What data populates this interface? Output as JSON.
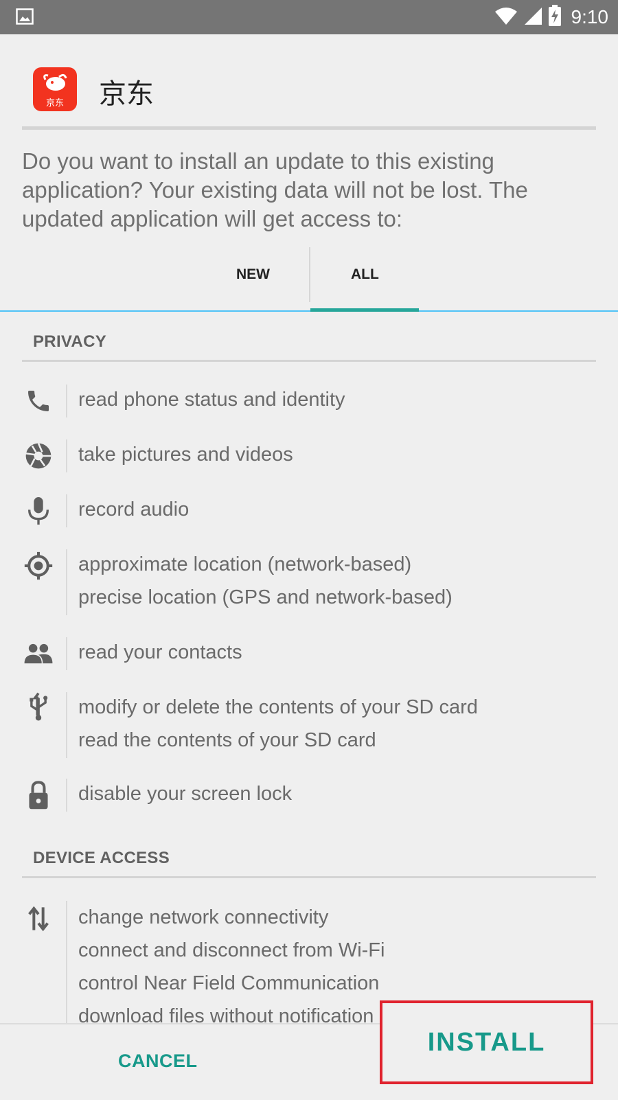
{
  "status_bar": {
    "time": "9:10",
    "icons": [
      "image-icon",
      "wifi-icon",
      "signal-icon",
      "battery-charging-icon"
    ]
  },
  "app": {
    "name": "京东",
    "icon_text": "京东",
    "icon_color": "#f2331f"
  },
  "message": "Do you want to install an update to this existing application? Your existing data will not be lost. The updated application will get access to:",
  "tabs": {
    "new": "NEW",
    "all": "ALL",
    "selected": "ALL"
  },
  "sections": {
    "privacy": {
      "title": "PRIVACY",
      "items": [
        {
          "icon": "phone-icon",
          "lines": [
            "read phone status and identity"
          ]
        },
        {
          "icon": "camera-icon",
          "lines": [
            "take pictures and videos"
          ]
        },
        {
          "icon": "microphone-icon",
          "lines": [
            "record audio"
          ]
        },
        {
          "icon": "location-icon",
          "lines": [
            "approximate location (network-based)",
            "precise location (GPS and network-based)"
          ]
        },
        {
          "icon": "contacts-icon",
          "lines": [
            "read your contacts"
          ]
        },
        {
          "icon": "usb-icon",
          "lines": [
            "modify or delete the contents of your SD card",
            "read the contents of your SD card"
          ]
        },
        {
          "icon": "lock-icon",
          "lines": [
            "disable your screen lock"
          ]
        }
      ]
    },
    "device_access": {
      "title": "DEVICE ACCESS",
      "items": [
        {
          "icon": "network-arrows-icon",
          "lines": [
            "change network connectivity",
            "connect and disconnect from Wi-Fi",
            "control Near Field Communication",
            "download files without notification"
          ]
        }
      ]
    }
  },
  "buttons": {
    "cancel": "CANCEL",
    "install": "INSTALL"
  },
  "colors": {
    "accent": "#17998a",
    "status_bar": "#757575",
    "highlight_box": "#e0232e"
  }
}
